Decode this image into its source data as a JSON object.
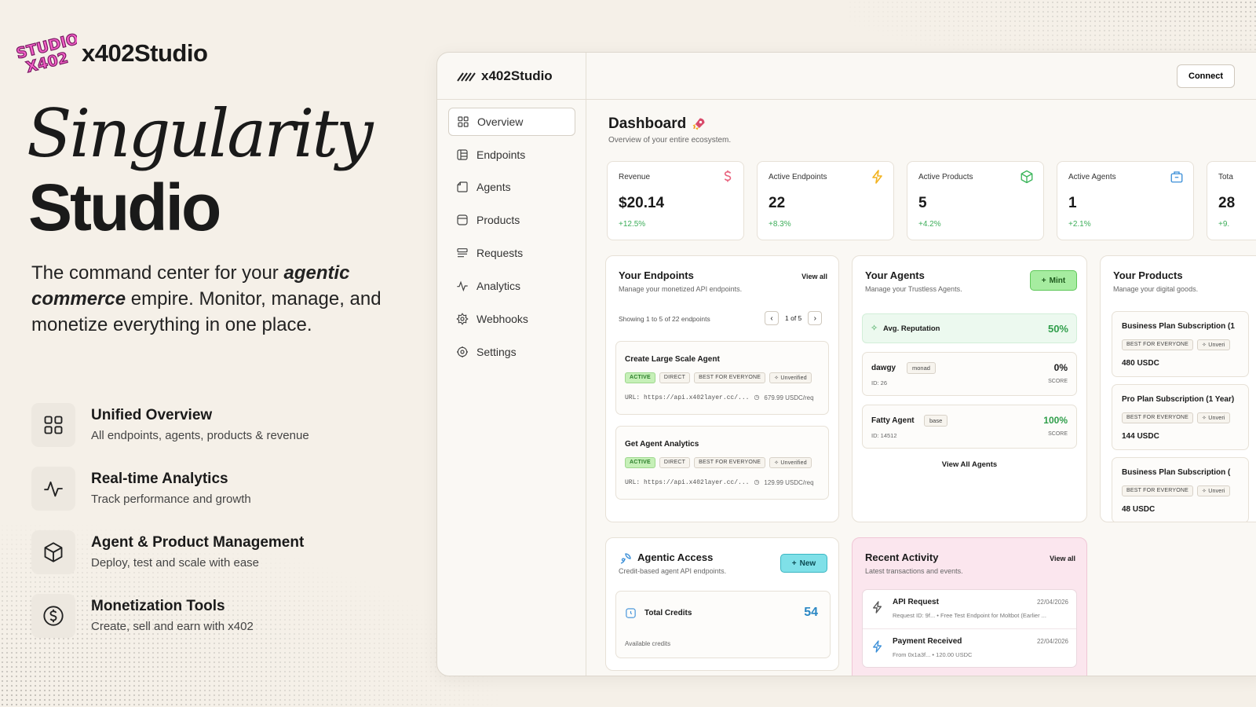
{
  "brand": {
    "name": "x402Studio",
    "logo_text": "STUDIO X402"
  },
  "hero": {
    "line1": "Singularity",
    "line2": "Studio",
    "tagline_pre": "The command center for your ",
    "tagline_em": "agentic commerce",
    "tagline_post": " empire. Monitor, manage, and monetize everything in one place."
  },
  "features": [
    {
      "icon": "grid-icon",
      "title": "Unified Overview",
      "desc": "All endpoints, agents, products & revenue"
    },
    {
      "icon": "pulse-icon",
      "title": "Real-time Analytics",
      "desc": "Track performance and growth"
    },
    {
      "icon": "cube-icon",
      "title": "Agent & Product Management",
      "desc": "Deploy, test and scale with ease"
    },
    {
      "icon": "dollar-icon",
      "title": "Monetization Tools",
      "desc": "Create, sell and earn with x402"
    }
  ],
  "app": {
    "logo": "x402Studio",
    "connect": "Connect",
    "nav": [
      {
        "icon": "grid-icon",
        "label": "Overview",
        "active": true
      },
      {
        "icon": "endpoints-icon",
        "label": "Endpoints"
      },
      {
        "icon": "agents-icon",
        "label": "Agents"
      },
      {
        "icon": "products-icon",
        "label": "Products"
      },
      {
        "icon": "requests-icon",
        "label": "Requests"
      },
      {
        "icon": "analytics-icon",
        "label": "Analytics"
      },
      {
        "icon": "webhooks-icon",
        "label": "Webhooks"
      },
      {
        "icon": "settings-icon",
        "label": "Settings"
      }
    ]
  },
  "dashboard": {
    "title": "Dashboard",
    "subtitle": "Overview of your entire ecosystem.",
    "stats": [
      {
        "label": "Revenue",
        "value": "$20.14",
        "delta": "+12.5%",
        "icon": "dollar-icon",
        "color": "#e8607c"
      },
      {
        "label": "Active Endpoints",
        "value": "22",
        "delta": "+8.3%",
        "icon": "bolt-icon",
        "color": "#f2b320"
      },
      {
        "label": "Active Products",
        "value": "5",
        "delta": "+4.2%",
        "icon": "box-icon",
        "color": "#3cb55b"
      },
      {
        "label": "Active Agents",
        "value": "1",
        "delta": "+2.1%",
        "icon": "bag-icon",
        "color": "#3b8fd8"
      },
      {
        "label": "Tota",
        "value": "28",
        "delta": "+9.",
        "icon": "",
        "color": ""
      }
    ]
  },
  "endpoints": {
    "title": "Your Endpoints",
    "subtitle": "Manage your monetized API endpoints.",
    "view_all": "View all",
    "showing": "Showing 1 to 5 of 22 endpoints",
    "page": "1 of 5",
    "items": [
      {
        "name": "Create Large Scale Agent",
        "tags": [
          "ACTIVE",
          "DIRECT",
          "BEST FOR EVERYONE",
          "Unverified"
        ],
        "url": "URL: https://api.x402layer.cc/...",
        "price": "679.99 USDC/req"
      },
      {
        "name": "Get Agent Analytics",
        "tags": [
          "ACTIVE",
          "DIRECT",
          "BEST FOR EVERYONE",
          "Unverified"
        ],
        "url": "URL: https://api.x402layer.cc/...",
        "price": "129.99 USDC/req"
      }
    ]
  },
  "agents": {
    "title": "Your Agents",
    "subtitle": "Manage your Trustless Agents.",
    "mint": "Mint",
    "reputation_label": "Avg. Reputation",
    "reputation_value": "50%",
    "list": [
      {
        "name": "dawgy",
        "chain": "monad",
        "id": "ID: 26",
        "score": "0%",
        "score_label": "SCORE"
      },
      {
        "name": "Fatty Agent",
        "chain": "base",
        "id": "ID: 14512",
        "score": "100%",
        "score_label": "SCORE"
      }
    ],
    "view_all": "View All Agents"
  },
  "products": {
    "title": "Your Products",
    "subtitle": "Manage your digital goods.",
    "list": [
      {
        "name": "Business Plan Subscription (1",
        "tags": [
          "BEST FOR EVERYONE",
          "Unveri"
        ],
        "price": "480 USDC"
      },
      {
        "name": "Pro Plan Subscription (1 Year)",
        "tags": [
          "BEST FOR EVERYONE",
          "Unveri"
        ],
        "price": "144 USDC"
      },
      {
        "name": "Business Plan Subscription (",
        "tags": [
          "BEST FOR EVERYONE",
          "Unveri"
        ],
        "price": "48 USDC"
      }
    ]
  },
  "agentic": {
    "title": "Agentic Access",
    "subtitle": "Credit-based agent API endpoints.",
    "new": "New",
    "credits_label": "Total Credits",
    "credits_value": "54",
    "credits_sub": "Available credits"
  },
  "activity": {
    "title": "Recent Activity",
    "subtitle": "Latest transactions and events.",
    "view_all": "View all",
    "items": [
      {
        "title": "API Request",
        "date": "22/04/2026",
        "detail": "Request ID: 9f...  •  Free Test Endpoint for Moltbot (Earlier ..."
      },
      {
        "title": "Payment Received",
        "date": "22/04/2026",
        "detail": "From 0x1a3f...  •  120.00 USDC"
      }
    ]
  },
  "colors": {
    "accent_green": "#3dae5a",
    "mint_green": "#a6eca0",
    "new_cyan": "#7fe0e8",
    "activity_pink": "#fbe6ee"
  }
}
